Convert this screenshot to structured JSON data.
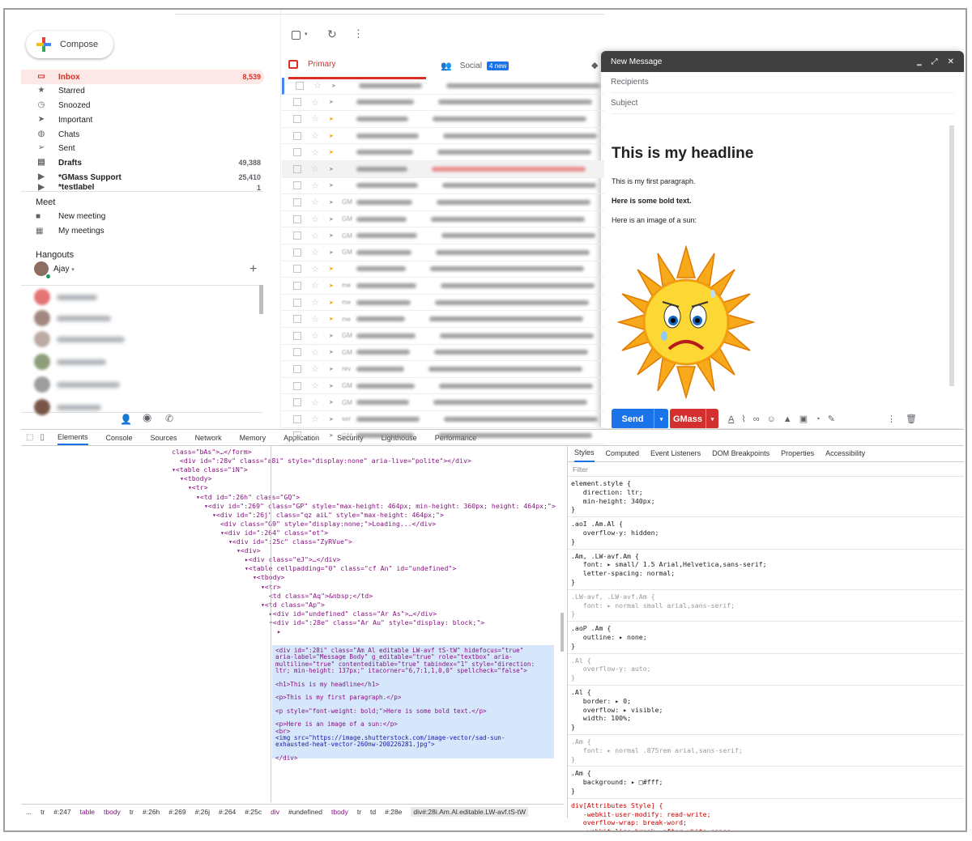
{
  "compose_label": "Compose",
  "nav": [
    {
      "label": "Inbox",
      "count": "8,539",
      "icon": "inbox-icon",
      "glyph": "▭"
    },
    {
      "label": "Starred",
      "count": "",
      "icon": "star-icon",
      "glyph": "★"
    },
    {
      "label": "Snoozed",
      "count": "",
      "icon": "clock-icon",
      "glyph": "◷"
    },
    {
      "label": "Important",
      "count": "",
      "icon": "important-icon",
      "glyph": "➤"
    },
    {
      "label": "Chats",
      "count": "",
      "icon": "chat-icon",
      "glyph": "◍"
    },
    {
      "label": "Sent",
      "count": "",
      "icon": "send-icon",
      "glyph": "➢"
    },
    {
      "label": "Drafts",
      "count": "49,388",
      "icon": "draft-icon",
      "glyph": "▤"
    },
    {
      "label": "*GMass Support",
      "count": "25,410",
      "icon": "label-icon",
      "glyph": "▶"
    },
    {
      "label": "*testlabel",
      "count": "1",
      "icon": "label-icon",
      "glyph": "▶"
    }
  ],
  "meet": {
    "title": "Meet",
    "new_meeting": "New meeting",
    "my_meetings": "My meetings"
  },
  "hangouts": {
    "title": "Hangouts",
    "user": "Ajay",
    "plus": "+"
  },
  "tabs": {
    "primary": "Primary",
    "social": "Social",
    "social_badge": "4 new"
  },
  "row_labels": [
    "",
    "",
    "",
    "",
    "",
    "",
    "",
    "GM",
    "GM",
    "GM",
    "GM",
    "",
    "me",
    "me",
    "me",
    "GM",
    "GM",
    "rev",
    "GM",
    "GM",
    "ser",
    "GM"
  ],
  "compose": {
    "title": "New Message",
    "recipients": "Recipients",
    "subject": "Subject",
    "headline": "This is my headline",
    "p1": "This is my first paragraph.",
    "p2": "Here is some bold text.",
    "p3": "Here is an image of a sun:",
    "send": "Send",
    "gmass": "GMass"
  },
  "devtools": {
    "tabs": [
      "Elements",
      "Console",
      "Sources",
      "Network",
      "Memory",
      "Application",
      "Security",
      "Lighthouse",
      "Performance"
    ],
    "style_tabs": [
      "Styles",
      "Computed",
      "Event Listeners",
      "DOM Breakpoints",
      "Properties",
      "Accessibility"
    ],
    "filter": "Filter",
    "lines": [
      "class=\"bAs\">…</form>",
      "<div id=\":28v\" class=\"a8i\" style=\"display:none\" aria-live=\"polite\"></div>",
      "▾<table class=\"iN\">",
      "▾<tbody>",
      "▾<tr>",
      "▾<td id=\":26h\" class=\"GQ\">",
      "▾<div id=\":269\" class=\"GP\" style=\"max-height: 464px; min-height: 360px; height: 464px;\">",
      "▾<div id=\":26j\" class=\"qz aiL\" style=\"max-height: 464px;\">",
      "<div class=\"G9\" style=\"display:none;\">Loading...</div>",
      "▾<div id=\":264\" class=\"et\">",
      "▾<div id=\":25c\" class=\"ZyRVue\">",
      "▾<div>",
      "▸<div class=\"eJ\">…</div>",
      "▾<table cellpadding=\"0\" class=\"cf An\" id=\"undefined\">",
      "▾<tbody>",
      "▾<tr>",
      "<td class=\"Aq\">&nbsp;</td>",
      "▾<td class=\"Ap\">",
      "▸<div id=\"undefined\" class=\"Ar As\">…</div>",
      "▾<div id=\":28e\" class=\"Ar Au\" style=\"display: block;\">",
      "▸"
    ],
    "sel_lines": [
      "<div id=\":28i\" class=\"Am Al editable LW-avf tS-tW\" hidefocus=\"true\"",
      "aria-label=\"Message Body\" g_editable=\"true\" role=\"textbox\" aria-",
      "multiline=\"true\" contenteditable=\"true\" tabindex=\"1\" style=\"direction:",
      "ltr; min-height: 137px;\" itacorner=\"6,7:1,1,0,0\" spellcheck=\"false\">",
      "",
      "<h1>This is my headline</h1>",
      "",
      "<p>This is my first paragraph.</p>",
      "",
      "<p style=\"font-weight: bold;\">Here is some bold text.</p>",
      "",
      "<p>Here is an image of a sun:</p>",
      "<br>",
      "<img src=\"https://image.shutterstock.com/image-vector/sad-sun-",
      "exhausted-heat-vector-260nw-200226281.jpg\">",
      "",
      "</div>"
    ],
    "rules": [
      "element.style {\n   direction: ltr;\n   min-height: 340px;\n}",
      ".aoI .Am.Al {\n   overflow-y: hidden;\n}",
      ".Am, .LW-avf.Am {\n   font: ▸ small/ 1.5 Arial,Helvetica,sans-serif;\n   letter-spacing: normal;\n}",
      ".LW-avf, .LW-avf.Am {\n   font: ▸ normal small arial,sans-serif;\n}",
      ".aoP .Am {\n   outline: ▸ none;\n}",
      ".Al {\n   overflow-y: auto;\n}",
      ".Al {\n   border: ▸ 0;\n   overflow: ▸ visible;\n   width: 100%;\n}",
      ".Am {\n   font: ▸ normal .875rem arial,sans-serif;\n}",
      ".Am {\n   background: ▸ □#fff;\n}",
      "div[Attributes Style] {\n   -webkit-user-modify: read-write;\n   overflow-wrap: break-word;\n   -webkit-line-break: after-white-space;"
    ],
    "crumbs": [
      "...",
      "tr",
      "#:247",
      "table",
      "tbody",
      "tr",
      "#:26h",
      "#:269",
      "#:26j",
      "#:264",
      "#:25c",
      "div",
      "#undefined",
      "tbody",
      "tr",
      "td",
      "#:28e",
      "div#:28i.Am.Al.editable.LW-avf.tS-tW"
    ]
  }
}
